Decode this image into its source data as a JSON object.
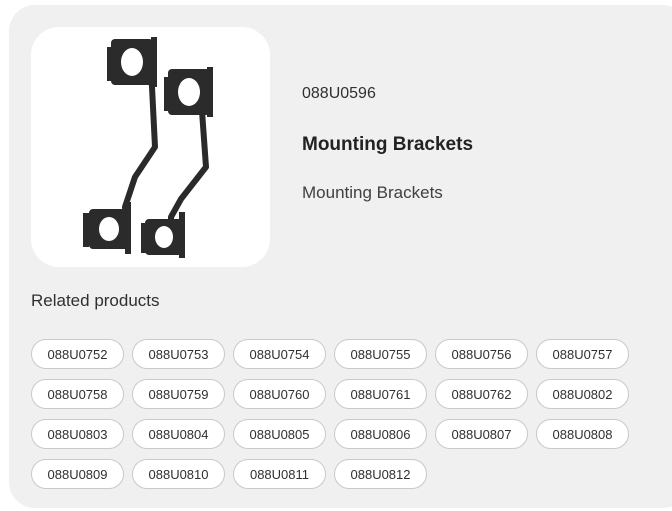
{
  "product": {
    "code": "088U0596",
    "title": "Mounting Brackets",
    "description": "Mounting Brackets",
    "image_icon": "mounting-brackets-image"
  },
  "related": {
    "heading": "Related products",
    "items": [
      "088U0752",
      "088U0753",
      "088U0754",
      "088U0755",
      "088U0756",
      "088U0757",
      "088U0758",
      "088U0759",
      "088U0760",
      "088U0761",
      "088U0762",
      "088U0802",
      "088U0803",
      "088U0804",
      "088U0805",
      "088U0806",
      "088U0807",
      "088U0808",
      "088U0809",
      "088U0810",
      "088U0811",
      "088U0812"
    ]
  },
  "colors": {
    "card_background": "#f0f0f0",
    "chip_border": "#c9c9c9",
    "text": "#303030"
  }
}
